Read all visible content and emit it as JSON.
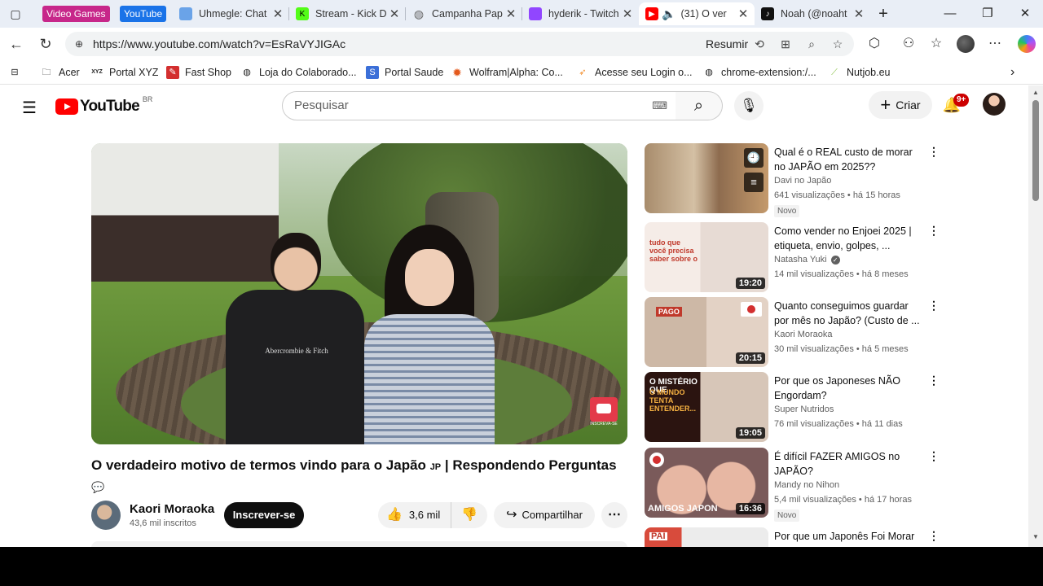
{
  "browser": {
    "tab_groups": [
      {
        "label": "Video Games",
        "color": "#c7278a"
      },
      {
        "label": "YouTube",
        "color": "#1a73e8"
      }
    ],
    "tabs": [
      {
        "title": "Uhmegle: Chat",
        "favicon": "#6aa3e8"
      },
      {
        "title": "Stream - Kick D",
        "favicon": "#53fc18"
      },
      {
        "title": "Campanha Pap",
        "favicon": "#999999"
      },
      {
        "title": "hyderik - Twitch",
        "favicon": "#9146ff"
      },
      {
        "title": "(31) O ver",
        "favicon": "#ff0000",
        "active": true
      },
      {
        "title": "Noah (@noaht",
        "favicon": "#111111"
      }
    ],
    "url": "https://www.youtube.com/watch?v=EsRaVYJIGAc",
    "resumir": "Resumir",
    "bookmarks": [
      {
        "label": "Acer",
        "icon": "folder-icon"
      },
      {
        "label": "Portal XYZ",
        "icon": "xyz-icon"
      },
      {
        "label": "Fast Shop",
        "icon": "fastshop-icon"
      },
      {
        "label": "Loja do Colaborado...",
        "icon": "globe-icon"
      },
      {
        "label": "Portal Saude",
        "icon": "saude-icon"
      },
      {
        "label": "Wolfram|Alpha: Co...",
        "icon": "wolfram-icon"
      },
      {
        "label": "Acesse seu Login o...",
        "icon": "login-icon"
      },
      {
        "label": "chrome-extension:/...",
        "icon": "globe-icon"
      },
      {
        "label": "Nutjob.eu",
        "icon": "nutjob-icon"
      }
    ]
  },
  "youtube": {
    "logo_text": "YouTube",
    "region": "BR",
    "search_placeholder": "Pesquisar",
    "create_label": "Criar",
    "notif_badge": "9+",
    "video": {
      "title": "O verdadeiro motivo de termos vindo para o Japão",
      "flag": "JP",
      "title_tail": "| Respondendo Perguntas",
      "channel": "Kaori Moraoka",
      "subscribers": "43,6 mil inscritos",
      "subscribe_label": "Inscrever-se",
      "likes": "3,6 mil",
      "share_label": "Compartilhar",
      "thumb_shirt": "Abercrombie & Fitch",
      "watermark_label": "INSCREVA-SE"
    },
    "recommendations": [
      {
        "title": "Qual é o REAL custo de morar no JAPÃO em 2025??",
        "channel": "Davi no Japão",
        "verified": false,
        "views": "641 visualizações",
        "age": "há 15 horas",
        "badge": "Novo",
        "duration": ""
      },
      {
        "title": "Como vender no Enjoei 2025 | etiqueta, envio, golpes, ...",
        "channel": "Natasha Yuki",
        "verified": true,
        "views": "14 mil visualizações",
        "age": "há 8 meses",
        "badge": "",
        "duration": "19:20"
      },
      {
        "title": "Quanto conseguimos guardar por mês no Japão? (Custo de ...",
        "channel": "Kaori Moraoka",
        "verified": false,
        "views": "30 mil visualizações",
        "age": "há 5 meses",
        "badge": "",
        "duration": "20:15"
      },
      {
        "title": "Por que os Japoneses NÃO Engordam?",
        "channel": "Super Nutridos",
        "verified": false,
        "views": "76 mil visualizações",
        "age": "há 11 dias",
        "badge": "",
        "duration": "19:05"
      },
      {
        "title": "É difícil FAZER AMIGOS  no JAPÃO?",
        "channel": "Mandy no Nihon",
        "verified": false,
        "views": "5,4 mil visualizações",
        "age": "há 17 horas",
        "badge": "Novo",
        "duration": "16:36"
      },
      {
        "title": "Por que um Japonês Foi Morar",
        "channel": "",
        "verified": false,
        "views": "",
        "age": "",
        "badge": "",
        "duration": ""
      }
    ],
    "thumb_texts": {
      "t2_a": "tudo que você precisa saber sobre o",
      "t4_a": "O MISTÉRIO QUE",
      "t4_b": "O MUNDO TENTA ENTENDER...",
      "t5_a": "AMIGOS JAPON",
      "t3_a": "PAGO",
      "t6_a": "PAI"
    }
  }
}
